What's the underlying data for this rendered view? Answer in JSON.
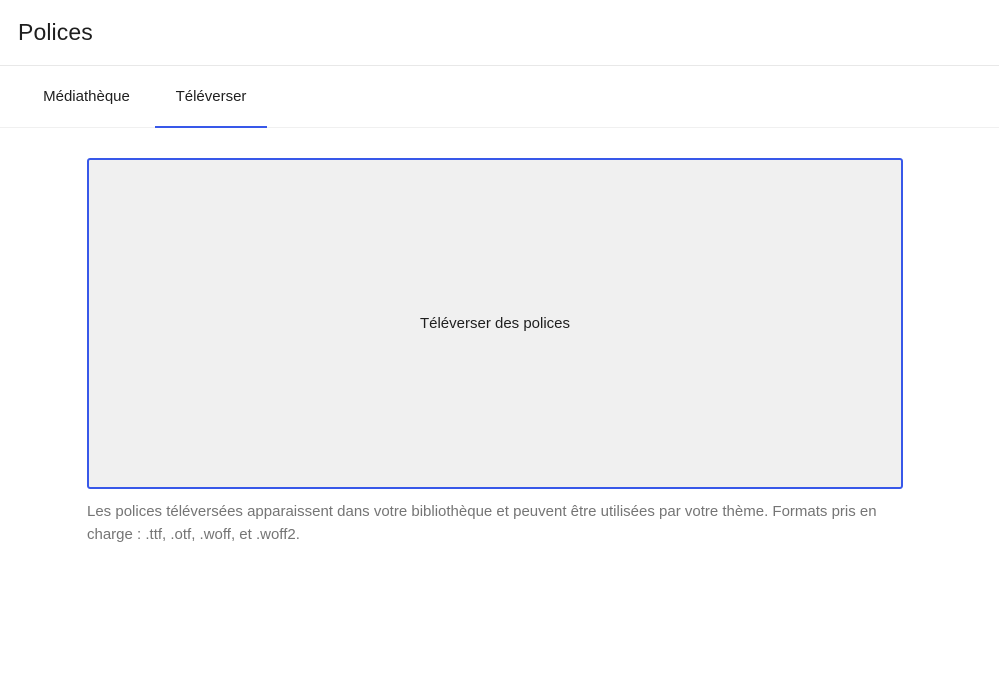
{
  "header": {
    "title": "Polices"
  },
  "tabs": [
    {
      "label": "Médiathèque",
      "active": false
    },
    {
      "label": "Téléverser",
      "active": true
    }
  ],
  "upload": {
    "dropzone_label": "Téléverser des polices",
    "help_text": "Les polices téléversées apparaissent dans votre bibliothèque et peuvent être utilisées par votre thème. Formats pris en charge : .ttf, .otf, .woff, et .woff2."
  },
  "colors": {
    "accent": "#3858e9",
    "dropzone_background": "#f0f0f0",
    "help_text": "#757575"
  }
}
